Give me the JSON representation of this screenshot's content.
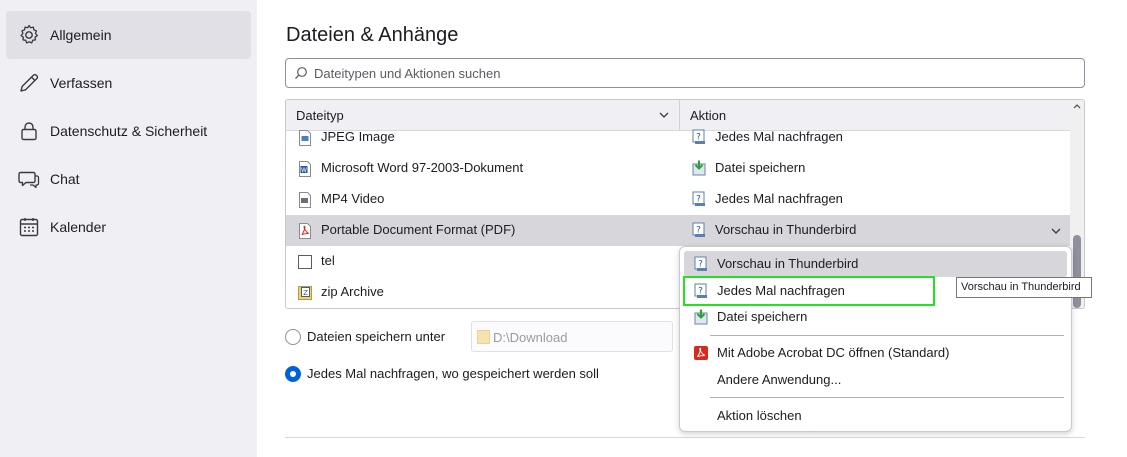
{
  "sidebar": {
    "items": [
      {
        "label": "Allgemein",
        "icon": "gear-icon",
        "active": true
      },
      {
        "label": "Verfassen",
        "icon": "pencil-icon"
      },
      {
        "label": "Datenschutz & Sicherheit",
        "icon": "lock-icon"
      },
      {
        "label": "Chat",
        "icon": "chat-icon"
      },
      {
        "label": "Kalender",
        "icon": "calendar-icon"
      }
    ]
  },
  "main": {
    "title": "Dateien & Anhänge",
    "search": {
      "placeholder": "Dateitypen und Aktionen suchen"
    },
    "table": {
      "columns": [
        "Dateityp",
        "Aktion"
      ],
      "rows": [
        {
          "type": "JPEG Image",
          "action": "Jedes Mal nachfragen",
          "type_icon": "image-file-icon",
          "action_icon": "ask-icon"
        },
        {
          "type": "Microsoft Word 97-2003-Dokument",
          "action": "Datei speichern",
          "type_icon": "word-file-icon",
          "action_icon": "save-file-icon"
        },
        {
          "type": "MP4 Video",
          "action": "Jedes Mal nachfragen",
          "type_icon": "video-file-icon",
          "action_icon": "ask-icon"
        },
        {
          "type": "Portable Document Format (PDF)",
          "action": "Vorschau in Thunderbird",
          "type_icon": "pdf-file-icon",
          "action_icon": "ask-icon",
          "selected": true
        },
        {
          "type": "tel",
          "action": "",
          "type_icon": "blank-file-icon"
        },
        {
          "type": "zip Archive",
          "action": "",
          "type_icon": "zip-file-icon"
        }
      ]
    },
    "save_options": {
      "save_to_label": "Dateien speichern unter",
      "folder": "D:\\Download",
      "ask_label": "Jedes Mal nachfragen, wo gespeichert werden soll",
      "selected": "ask"
    }
  },
  "action_menu": {
    "items": [
      {
        "label": "Vorschau in Thunderbird",
        "icon": "ask-icon",
        "highlighted": true
      },
      {
        "label": "Jedes Mal nachfragen",
        "icon": "ask-icon"
      },
      {
        "label": "Datei speichern",
        "icon": "save-file-icon"
      },
      {
        "label": "Mit Adobe Acrobat DC öffnen (Standard)",
        "icon": "acrobat-icon"
      },
      {
        "label": "Andere Anwendung...",
        "icon": ""
      },
      {
        "label": "Aktion löschen",
        "icon": ""
      }
    ]
  },
  "tooltip": "Vorschau in Thunderbird",
  "colors": {
    "accent": "#0061e0",
    "focus_outline": "#22e222",
    "selection": "#d7d7db"
  }
}
